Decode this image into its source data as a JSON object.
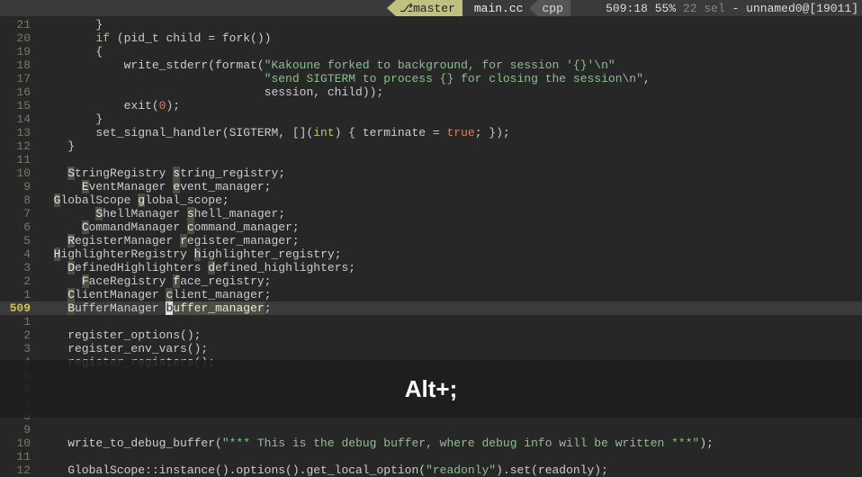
{
  "status": {
    "branch_icon": "⎇",
    "branch": "master",
    "file": "main.cc",
    "lang": "cpp",
    "pos": "509:18",
    "percent": "55%",
    "sel": "22 sel",
    "tail": " - unnamed0@[19011]"
  },
  "overlay": {
    "text": "Alt+;"
  },
  "lines": [
    {
      "n": "21",
      "segs": [
        {
          "t": "        }"
        }
      ]
    },
    {
      "n": "20",
      "segs": [
        {
          "t": "        "
        },
        {
          "t": "if",
          "c": "kw"
        },
        {
          "t": " (pid_t child = fork())"
        }
      ]
    },
    {
      "n": "19",
      "segs": [
        {
          "t": "        {"
        }
      ]
    },
    {
      "n": "18",
      "segs": [
        {
          "t": "            write_stderr(format("
        },
        {
          "t": "\"Kakoune forked to background, for session '{}'\\n\"",
          "c": "str"
        }
      ]
    },
    {
      "n": "17",
      "segs": [
        {
          "t": "                                "
        },
        {
          "t": "\"send SIGTERM to process {} for closing the session\\n\"",
          "c": "str"
        },
        {
          "t": ","
        }
      ]
    },
    {
      "n": "16",
      "segs": [
        {
          "t": "                                session, child));"
        }
      ]
    },
    {
      "n": "15",
      "segs": [
        {
          "t": "            exit("
        },
        {
          "t": "0",
          "c": "num"
        },
        {
          "t": ");"
        }
      ]
    },
    {
      "n": "14",
      "segs": [
        {
          "t": "        }"
        }
      ]
    },
    {
      "n": "13",
      "segs": [
        {
          "t": "        set_signal_handler(SIGTERM, []("
        },
        {
          "t": "int",
          "c": "kw"
        },
        {
          "t": ") { terminate = "
        },
        {
          "t": "true",
          "c": "bool"
        },
        {
          "t": "; });"
        }
      ]
    },
    {
      "n": "12",
      "segs": [
        {
          "t": "    }"
        }
      ]
    },
    {
      "n": "11",
      "segs": [
        {
          "t": ""
        }
      ]
    },
    {
      "n": "10",
      "segs": [
        {
          "t": "    "
        },
        {
          "t": "S",
          "c": "sel"
        },
        {
          "t": "tringRegistry "
        },
        {
          "t": "s",
          "c": "sel"
        },
        {
          "t": "tring_registry;"
        }
      ]
    },
    {
      "n": "9",
      "segs": [
        {
          "t": "      "
        },
        {
          "t": "E",
          "c": "sel"
        },
        {
          "t": "ventManager "
        },
        {
          "t": "e",
          "c": "sel"
        },
        {
          "t": "vent_manager;"
        }
      ]
    },
    {
      "n": "8",
      "segs": [
        {
          "t": "  "
        },
        {
          "t": "G",
          "c": "sel"
        },
        {
          "t": "lobalScope "
        },
        {
          "t": "g",
          "c": "sel"
        },
        {
          "t": "lobal_scope;"
        }
      ]
    },
    {
      "n": "7",
      "segs": [
        {
          "t": "        "
        },
        {
          "t": "S",
          "c": "sel"
        },
        {
          "t": "hellManager "
        },
        {
          "t": "s",
          "c": "sel"
        },
        {
          "t": "hell_manager;"
        }
      ]
    },
    {
      "n": "6",
      "segs": [
        {
          "t": "      "
        },
        {
          "t": "C",
          "c": "sel"
        },
        {
          "t": "ommandManager "
        },
        {
          "t": "c",
          "c": "sel"
        },
        {
          "t": "ommand_manager;"
        }
      ]
    },
    {
      "n": "5",
      "segs": [
        {
          "t": "    "
        },
        {
          "t": "R",
          "c": "sel"
        },
        {
          "t": "egisterManager "
        },
        {
          "t": "r",
          "c": "sel"
        },
        {
          "t": "egister_manager;"
        }
      ]
    },
    {
      "n": "4",
      "segs": [
        {
          "t": "  "
        },
        {
          "t": "H",
          "c": "sel"
        },
        {
          "t": "ighlighterRegistry "
        },
        {
          "t": "h",
          "c": "sel"
        },
        {
          "t": "ighlighter_registry;"
        }
      ]
    },
    {
      "n": "3",
      "segs": [
        {
          "t": "    "
        },
        {
          "t": "D",
          "c": "sel"
        },
        {
          "t": "efinedHighlighters "
        },
        {
          "t": "d",
          "c": "sel"
        },
        {
          "t": "efined_highlighters;"
        }
      ]
    },
    {
      "n": "2",
      "segs": [
        {
          "t": "      "
        },
        {
          "t": "F",
          "c": "sel"
        },
        {
          "t": "aceRegistry "
        },
        {
          "t": "f",
          "c": "sel"
        },
        {
          "t": "ace_registry;"
        }
      ]
    },
    {
      "n": "1",
      "segs": [
        {
          "t": "    "
        },
        {
          "t": "C",
          "c": "sel"
        },
        {
          "t": "lientManager "
        },
        {
          "t": "c",
          "c": "sel"
        },
        {
          "t": "lient_manager;"
        }
      ]
    },
    {
      "n": "509",
      "cur": true,
      "segs": [
        {
          "t": "    "
        },
        {
          "t": "B",
          "c": "sel"
        },
        {
          "t": "ufferManager "
        },
        {
          "t": "b",
          "c": "cursor-sel"
        },
        {
          "t": "uffer_manager",
          "c": "sel"
        },
        {
          "t": ";"
        }
      ]
    },
    {
      "n": "1",
      "segs": [
        {
          "t": ""
        }
      ]
    },
    {
      "n": "2",
      "segs": [
        {
          "t": "    register_options();"
        }
      ]
    },
    {
      "n": "3",
      "segs": [
        {
          "t": "    register_env_vars();"
        }
      ]
    },
    {
      "n": "4",
      "segs": [
        {
          "t": "    register_registers();"
        }
      ]
    },
    {
      "n": "5",
      "segs": [
        {
          "t": ""
        }
      ]
    },
    {
      "n": "6",
      "segs": [
        {
          "t": ""
        }
      ]
    },
    {
      "n": "7",
      "segs": [
        {
          "t": ""
        }
      ]
    },
    {
      "n": "8",
      "segs": [
        {
          "t": ""
        }
      ]
    },
    {
      "n": "9",
      "segs": [
        {
          "t": ""
        }
      ]
    },
    {
      "n": "10",
      "segs": [
        {
          "t": "    write_to_debug_buffer("
        },
        {
          "t": "\"*** This is the debug buffer, where debug info will be written ***\"",
          "c": "str"
        },
        {
          "t": ");"
        }
      ]
    },
    {
      "n": "11",
      "segs": [
        {
          "t": ""
        }
      ]
    },
    {
      "n": "12",
      "segs": [
        {
          "t": "    GlobalScope::instance().options().get_local_option("
        },
        {
          "t": "\"readonly\"",
          "c": "str"
        },
        {
          "t": ").set(readonly);"
        }
      ]
    }
  ]
}
